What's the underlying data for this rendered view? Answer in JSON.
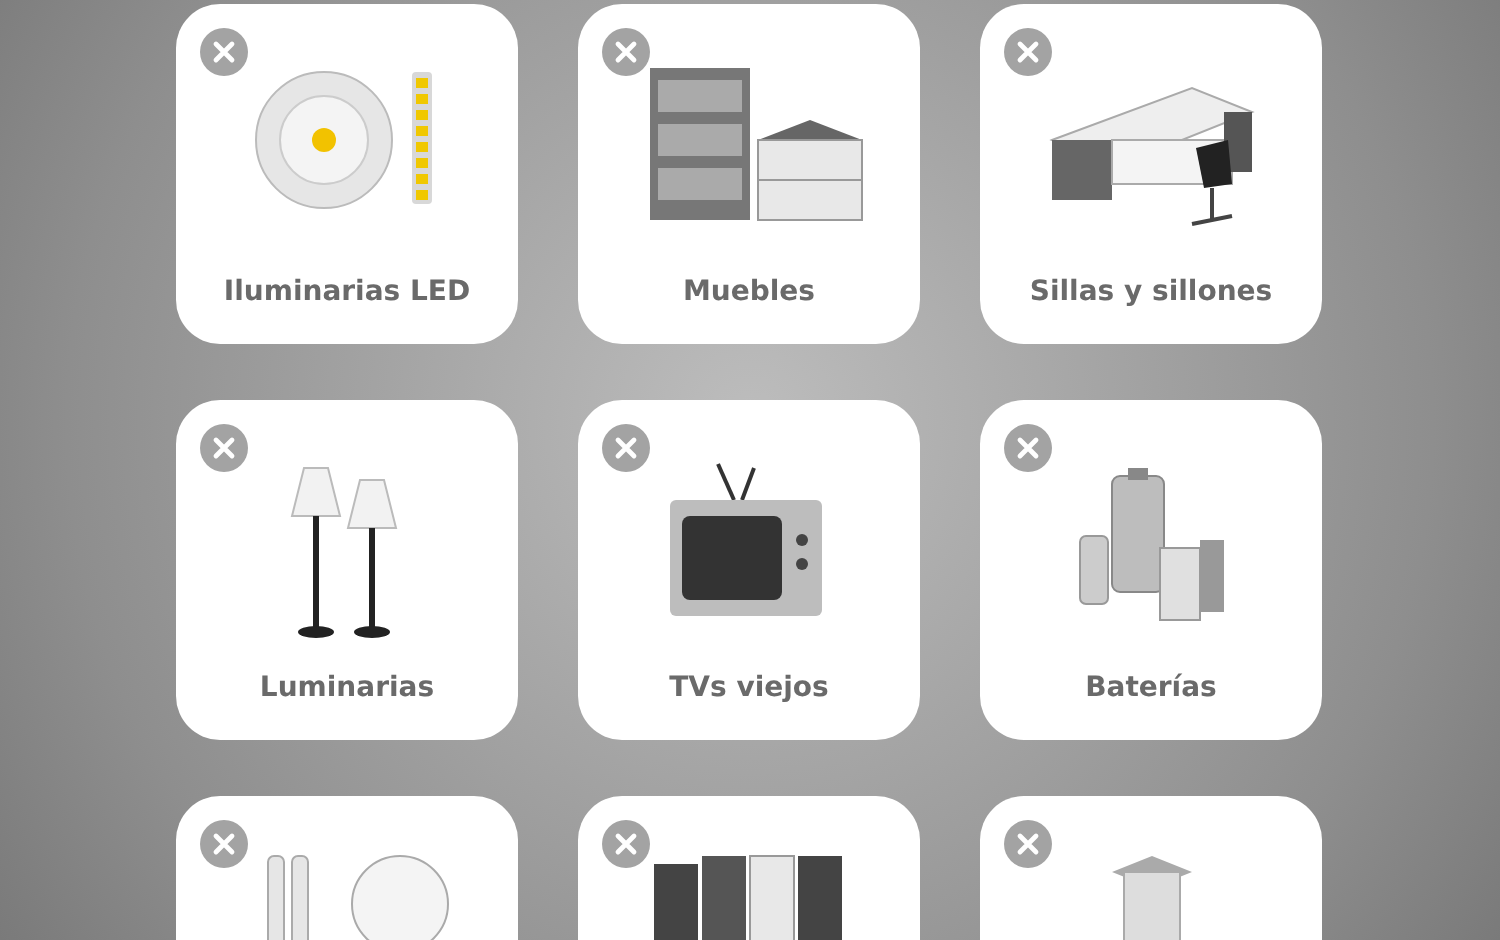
{
  "categories": [
    {
      "kind": "led-light",
      "label": "Iluminarias LED"
    },
    {
      "kind": "furniture",
      "label": "Muebles"
    },
    {
      "kind": "sofa-chair",
      "label": "Sillas y sillones"
    },
    {
      "kind": "floor-lamps",
      "label": "Luminarias"
    },
    {
      "kind": "tv",
      "label": "TVs viejos"
    },
    {
      "kind": "batteries",
      "label": "Baterías"
    },
    {
      "kind": "bulbs"
    },
    {
      "kind": "cartridges"
    },
    {
      "kind": "pillar"
    }
  ]
}
